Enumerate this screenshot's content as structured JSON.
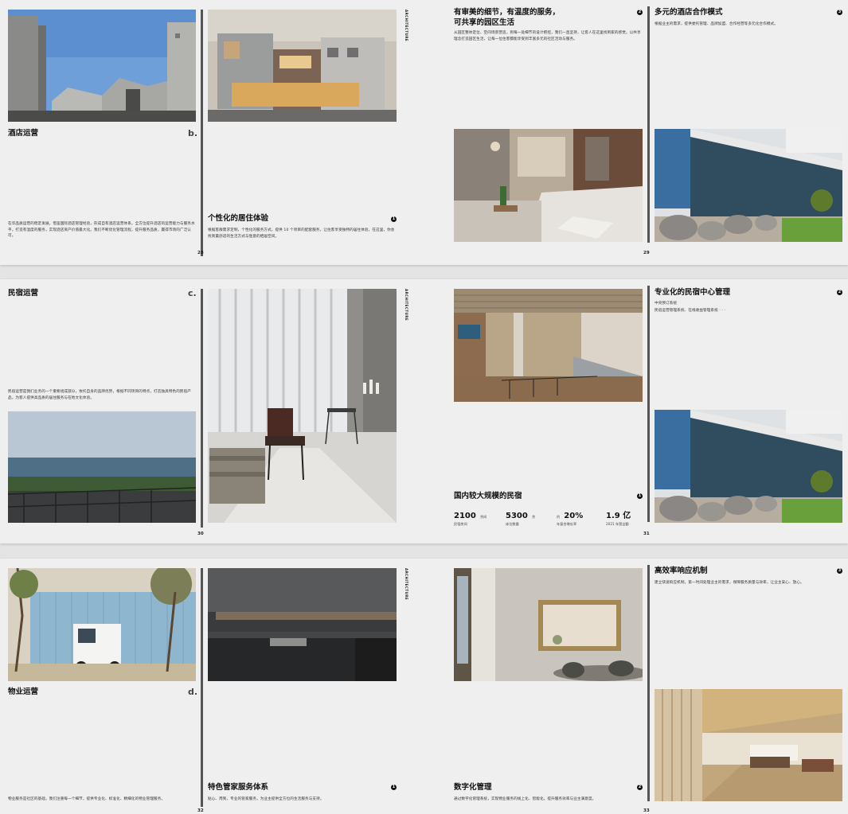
{
  "row1": {
    "left": {
      "title": "酒店运营",
      "letter": "b.",
      "body": "在华品质运营的稳定发展，借鉴国际酒店管理经验，形成自有酒店运营体系，全方位提升酒店的运营能力与服务水平，打造有温度的服务，实现酒店资产价值最大化。我们不断优化管理流程，提升服务品质，赢得市场的广泛认可。",
      "sub_title": "个性化的居住体验",
      "sub_num": "1",
      "sub_body": "根据客群需求定制，个性化的服务方式，提供 10 个项目的配套服务，让住客享受独特的居住体验，在这里，你会找到最舒适的生活方式与惬意的栖居空间。",
      "page_no": "28"
    },
    "right": {
      "c1_title_1": "有审美的细节，有温度的服务，",
      "c1_title_2": "可共享的园区生活",
      "c1_num": "2",
      "c1_body": "从园区整体定位、空间场景营造，到每一处细节的设计把控，我们一直坚持，让客人在这里找到家的感觉。以共享理念打造园区生活，让每一位住客都能享受到丰富多元的社区活动与服务。",
      "c2_title": "多元的酒店合作模式",
      "c2_num": "3",
      "c2_body": "根据业主的需求，提供委托管理、品牌加盟、合作经营等多元化合作模式。",
      "page_no": "29",
      "spine": "ARCHITECTURE"
    }
  },
  "row2": {
    "left": {
      "title": "民宿运营",
      "letter": "c.",
      "body": "民宿运营是我们业务的一个重要组成部分，依托自身的品牌优势，根据不同项目的特点，打造独具特色的民宿产品，为客人提供高品质的居住服务与在地文化体验。",
      "page_no": "30"
    },
    "right": {
      "top_title": "专业化的民宿中心管理",
      "top_num": "2",
      "top_body_1": "中央预订系统",
      "top_body_2": "民宿运营管理系统、在线收益管理系统 · · ·",
      "scale_title": "国内较大规模的民宿",
      "scale_num": "1",
      "stats": [
        {
          "big": "2100",
          "unit": "余间",
          "label": "民宿房间"
        },
        {
          "big": "5300",
          "unit": "余",
          "label": "床位数量"
        },
        {
          "big": "20%",
          "unit": "约",
          "label": "年复合增长率"
        },
        {
          "big": "1.9 亿",
          "unit": "",
          "label": "2021 年营业额"
        }
      ],
      "page_no": "31"
    }
  },
  "row3": {
    "left": {
      "title": "物业运营",
      "letter": "d.",
      "body": "物业服务是社区的基础，我们注重每一个细节，提供专业化、标准化、精细化的物业管理服务。",
      "sub_title": "特色管家服务体系",
      "sub_num": "1",
      "sub_body": "贴心、周到、专业的管家服务，为业主提供全方位的生活服务与支持。",
      "page_no": "32",
      "sign_text": "···"
    },
    "right": {
      "digital_title": "数字化管理",
      "digital_num": "2",
      "digital_body": "通过数字化管理系统，实现物业服务的线上化、智能化，提升服务效率与业主满意度。",
      "eff_title": "高效率响应机制",
      "eff_num": "3",
      "eff_body": "建立快速响应机制，第一时间处理业主的需求，保障服务质量与效率，让业主安心、放心。",
      "page_no": "33"
    }
  }
}
